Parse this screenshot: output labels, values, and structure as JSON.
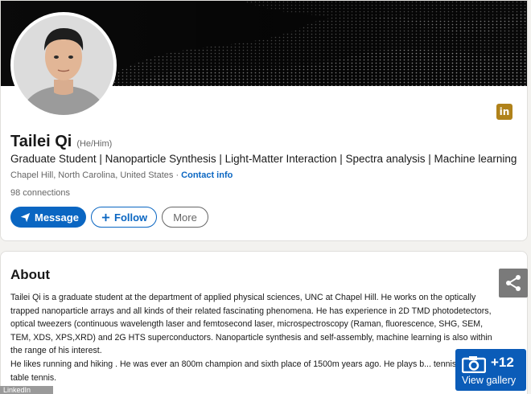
{
  "profile": {
    "name": "Tailei Qi",
    "pronouns": "(He/Him)",
    "headline": "Graduate Student | Nanoparticle Synthesis | Light-Matter Interaction | Spectra analysis | Machine learning",
    "location": "Chapel Hill, North Carolina, United States",
    "location_separator": "·",
    "contact_link": "Contact info",
    "connections": "98 connections",
    "badge_text": "in"
  },
  "actions": {
    "message_label": "Message",
    "follow_label": "Follow",
    "more_label": "More"
  },
  "about": {
    "title": "About",
    "paragraph_1": "Tailei Qi is a graduate student at the department of applied physical sciences, UNC at Chapel Hill. He works on the optically trapped nanoparticle arrays and all kinds of their related fascinating phenomena. He has experience in 2D TMD photodetectors, optical tweezers (continuous wavelength laser and femtosecond laser, microspectroscopy (Raman, fluorescence, SHG, SEM, TEM, XDS, XPS,XRD) and 2G HTS superconductors. Nanoparticle synthesis and self-assembly, machine learning is also within the range of his interest.",
    "paragraph_2": "He likes running and hiking . He was ever an 800m champion and sixth place of 1500m years ago. He plays b... tennis and table tennis."
  },
  "overlay": {
    "gallery_count": "+12",
    "gallery_label": "View gallery",
    "watermark": "LinkedIn"
  },
  "colors": {
    "accent": "#0a66c2",
    "gallery_blue": "#0b5cb8",
    "badge_gold": "#b0821a",
    "share_gray": "#7a7a7a"
  },
  "icons": [
    "paper-plane-icon",
    "plus-icon",
    "linkedin-badge-icon",
    "share-icon",
    "camera-icon"
  ]
}
